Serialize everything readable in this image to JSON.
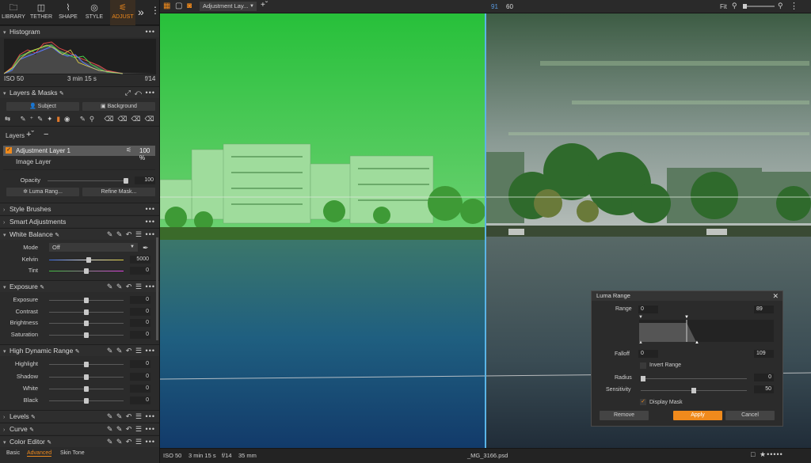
{
  "tabs": [
    {
      "label": "LIBRARY",
      "icon": "folder-icon"
    },
    {
      "label": "TETHER",
      "icon": "camera-icon"
    },
    {
      "label": "SHAPE",
      "icon": "shape-icon"
    },
    {
      "label": "STYLE",
      "icon": "style-icon"
    },
    {
      "label": "ADJUST",
      "icon": "sliders-icon"
    }
  ],
  "histogram": {
    "title": "Histogram",
    "iso": "ISO 50",
    "shutter": "3 min 15 s",
    "aperture": "f/14"
  },
  "layers_masks": {
    "title": "Layers & Masks",
    "subject_btn": "Subject",
    "background_btn": "Background"
  },
  "layers": {
    "label": "Layers",
    "items": [
      {
        "name": "Adjustment Layer 1",
        "percent": "100 %"
      },
      {
        "name": "Image Layer"
      }
    ],
    "opacity_label": "Opacity",
    "opacity_value": "100",
    "opacity": 1.0,
    "luma_btn": "Luma Rang...",
    "refine_btn": "Refine Mask..."
  },
  "style_brushes": "Style Brushes",
  "smart_adjustments": "Smart Adjustments",
  "white_balance": {
    "title": "White Balance",
    "mode_label": "Mode",
    "mode_value": "Off",
    "kelvin_label": "Kelvin",
    "kelvin_value": "5000",
    "tint_label": "Tint",
    "tint_value": "0"
  },
  "exposure": {
    "title": "Exposure",
    "rows": [
      {
        "label": "Exposure",
        "value": "0"
      },
      {
        "label": "Contrast",
        "value": "0"
      },
      {
        "label": "Brightness",
        "value": "0"
      },
      {
        "label": "Saturation",
        "value": "0"
      }
    ]
  },
  "hdr": {
    "title": "High Dynamic Range",
    "rows": [
      {
        "label": "Highlight",
        "value": "0"
      },
      {
        "label": "Shadow",
        "value": "0"
      },
      {
        "label": "White",
        "value": "0"
      },
      {
        "label": "Black",
        "value": "0"
      }
    ]
  },
  "levels": "Levels",
  "curve": "Curve",
  "color_editor": {
    "title": "Color Editor",
    "tabs": [
      "Basic",
      "Advanced",
      "Skin Tone"
    ],
    "active_tab": "Advanced"
  },
  "topbar": {
    "layer_select": "Adjustment Lay...",
    "num_a": "91",
    "num_b": "60",
    "fit": "Fit"
  },
  "bottombar": {
    "iso": "ISO 50",
    "shutter": "3 min 15 s",
    "aperture": "f/14",
    "focal": "35 mm",
    "filename": "_MG_3166.psd"
  },
  "luma_dialog": {
    "title": "Luma Range",
    "range_label": "Range",
    "range_min": "0",
    "range_max": "89",
    "falloff_label": "Falloff",
    "falloff_min": "0",
    "falloff_max": "109",
    "invert_label": "Invert Range",
    "invert_checked": false,
    "radius_label": "Radius",
    "radius_value": "0",
    "sensitivity_label": "Sensitivity",
    "sensitivity_value": "50",
    "display_mask_label": "Display Mask",
    "display_mask_checked": true,
    "remove_btn": "Remove",
    "apply_btn": "Apply",
    "cancel_btn": "Cancel"
  },
  "colors": {
    "accent": "#f08a1c",
    "mask_green": "#35c441",
    "divider": "#5ab4e6"
  }
}
